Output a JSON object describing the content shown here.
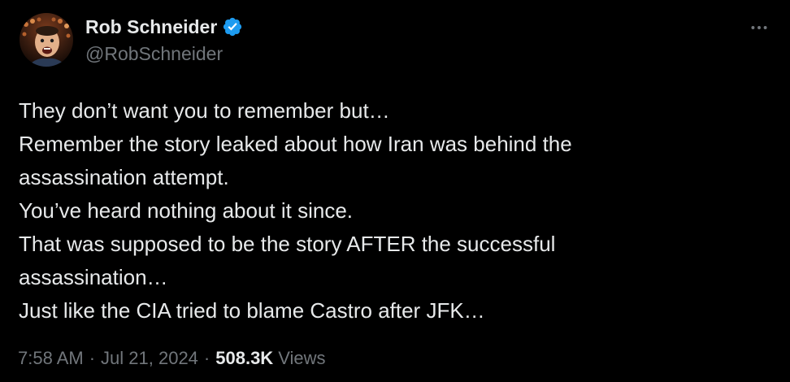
{
  "author": {
    "display_name": "Rob Schneider",
    "handle": "@RobSchneider",
    "verified_icon": "verified-badge-icon",
    "avatar_icon": "profile-avatar"
  },
  "menu": {
    "more_icon": "more-options-icon"
  },
  "tweet": {
    "lines": [
      "They don’t want you to remember but…",
      "Remember the story leaked about how Iran was behind the",
      "assassination attempt.",
      "You’ve heard nothing about it since.",
      "That was supposed to be the story AFTER the successful",
      "assassination…",
      "Just like the CIA tried to blame Castro after JFK…"
    ]
  },
  "meta": {
    "time": "7:58 AM",
    "separator": "·",
    "date": "Jul 21, 2024",
    "views_count": "508.3K",
    "views_label": "Views"
  },
  "colors": {
    "background": "#000000",
    "primary_text": "#e7e9ea",
    "secondary_text": "#71767b",
    "verified_blue": "#1d9bf0"
  }
}
